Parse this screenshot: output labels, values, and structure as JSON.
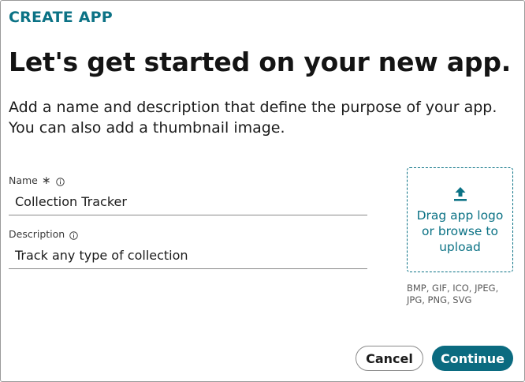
{
  "dialog": {
    "eyebrow": "CREATE APP",
    "title": "Let's get started on your new app.",
    "subtitle": "Add a name and description that define the purpose of your app. You can also add a thumbnail image."
  },
  "form": {
    "name_label": "Name",
    "name_required_marker": "∗",
    "name_value": "Collection Tracker",
    "description_label": "Description",
    "description_value": "Track any type of collection"
  },
  "thumbnail": {
    "dropzone_text": "Drag app logo or browse to upload",
    "formats_text": "BMP, GIF, ICO, JPEG, JPG, PNG, SVG",
    "icon": "upload-icon"
  },
  "actions": {
    "cancel_label": "Cancel",
    "continue_label": "Continue"
  },
  "colors": {
    "accent": "#0b7285",
    "primary_button": "#0b6b80",
    "text": "#1b1b1b"
  }
}
